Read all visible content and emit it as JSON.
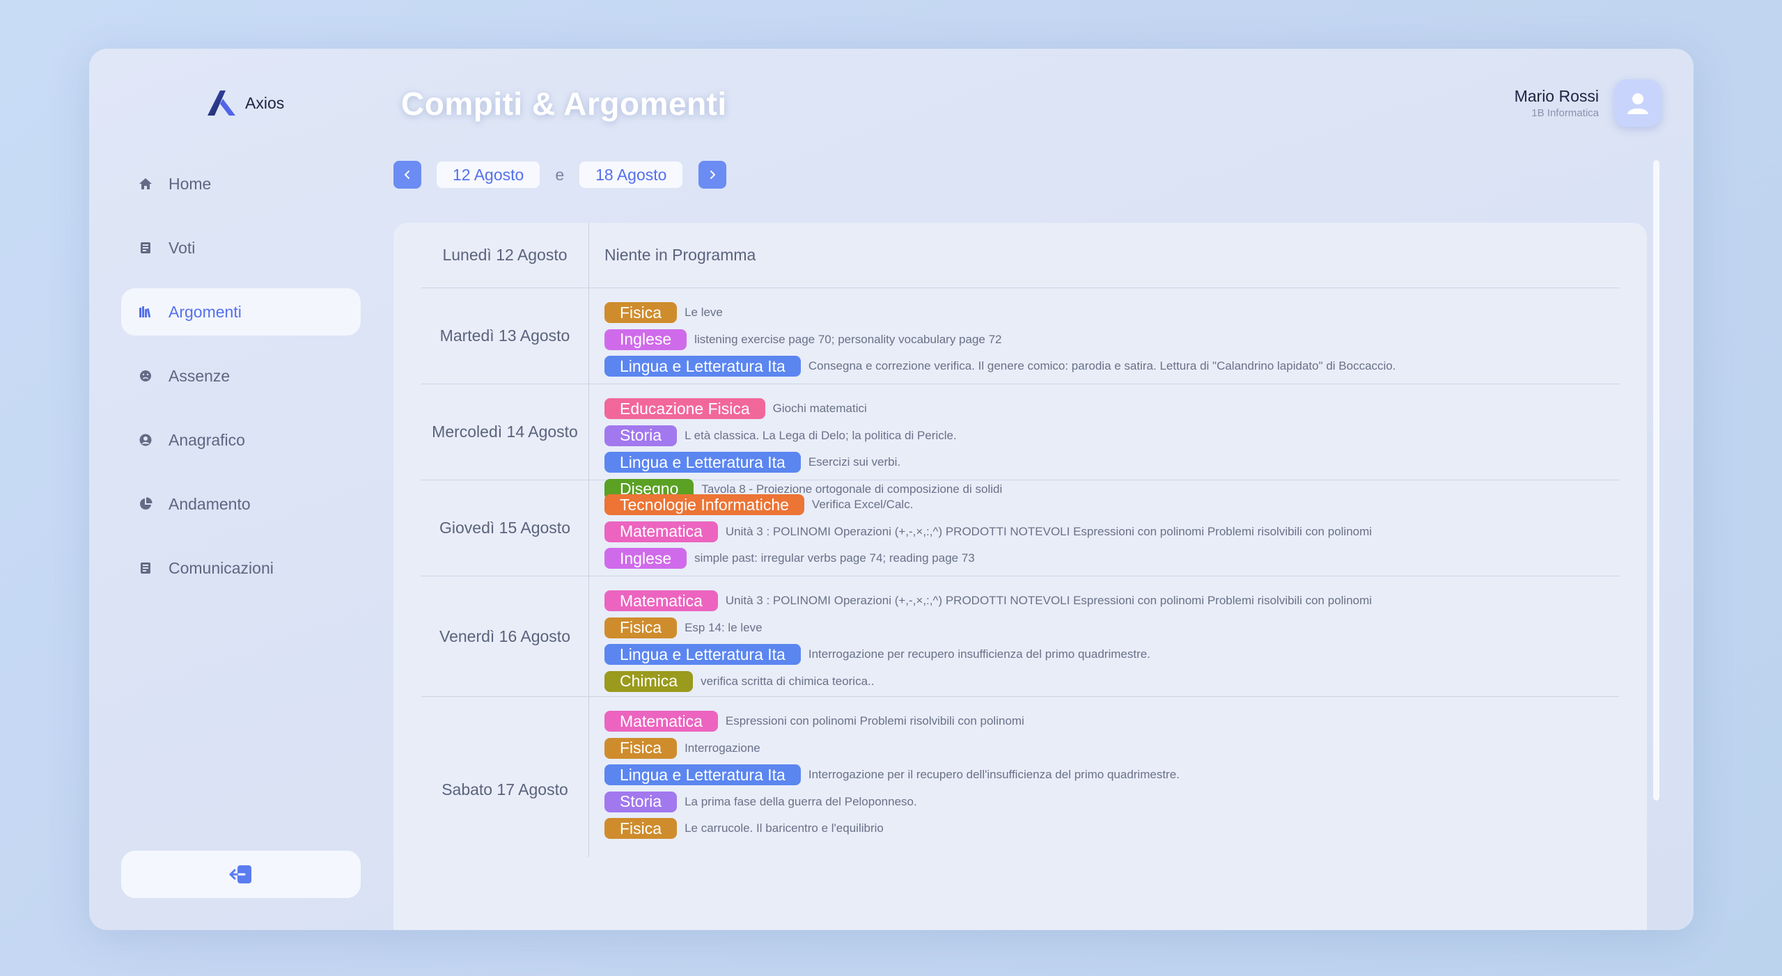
{
  "app": {
    "name": "Axios"
  },
  "page": {
    "title": "Compiti & Argomenti"
  },
  "user": {
    "name": "Mario Rossi",
    "class": "1B Informatica"
  },
  "sidebar": {
    "items": [
      {
        "label": "Home",
        "icon": "home-icon",
        "active": false
      },
      {
        "label": "Voti",
        "icon": "book-icon",
        "active": false
      },
      {
        "label": "Argomenti",
        "icon": "books-icon",
        "active": true
      },
      {
        "label": "Assenze",
        "icon": "face-icon",
        "active": false
      },
      {
        "label": "Anagrafico",
        "icon": "user-circle-icon",
        "active": false
      },
      {
        "label": "Andamento",
        "icon": "pie-chart-icon",
        "active": false
      },
      {
        "label": "Comunicazioni",
        "icon": "document-icon",
        "active": false
      }
    ]
  },
  "range": {
    "from": "12 Agosto",
    "separator": "e",
    "to": "18 Agosto"
  },
  "colors": {
    "accent": "#5570ec",
    "Fisica": "#cf8c2c",
    "Inglese": "#cf6bea",
    "Lingua e Letteratura Ita": "#5b86f0",
    "Educazione Fisica": "#f2679a",
    "Storia": "#a278ee",
    "Disegno": "#5aa124",
    "Tecnologie Informatiche": "#ec7435",
    "Matematica": "#ec64bf",
    "Chimica": "#9a9a1c"
  },
  "days": [
    {
      "label": "Lunedì 12 Agosto",
      "empty": "Niente in Programma",
      "items": []
    },
    {
      "label": "Martedì 13 Agosto",
      "items": [
        {
          "subject": "Fisica",
          "desc": "Le leve"
        },
        {
          "subject": "Inglese",
          "desc": "listening exercise page 70; personality vocabulary page 72"
        },
        {
          "subject": "Lingua e Letteratura Ita",
          "desc": "Consegna e correzione verifica. Il genere comico: parodia e satira. Lettura di \"Calandrino lapidato\" di Boccaccio."
        }
      ]
    },
    {
      "label": "Mercoledì 14 Agosto",
      "items": [
        {
          "subject": "Educazione Fisica",
          "desc": "Giochi matematici"
        },
        {
          "subject": "Storia",
          "desc": "L età classica. La Lega di Delo; la politica di Pericle."
        },
        {
          "subject": "Lingua e Letteratura Ita",
          "desc": "Esercizi sui verbi."
        },
        {
          "subject": "Disegno",
          "desc": "Tavola 8 - Proiezione ortogonale di composizione di solidi"
        }
      ]
    },
    {
      "label": "Giovedì 15 Agosto",
      "items": [
        {
          "subject": "Tecnologie Informatiche",
          "desc": "Verifica Excel/Calc."
        },
        {
          "subject": "Matematica",
          "desc": "Unità 3 : POLINOMI Operazioni (+,-,×,:,^) PRODOTTI NOTEVOLI Espressioni con polinomi Problemi risolvibili con polinomi"
        },
        {
          "subject": "Inglese",
          "desc": "simple past: irregular verbs page 74; reading page 73"
        }
      ]
    },
    {
      "label": "Venerdì 16 Agosto",
      "items": [
        {
          "subject": "Matematica",
          "desc": "Unità 3 : POLINOMI Operazioni (+,-,×,:,^) PRODOTTI NOTEVOLI Espressioni con polinomi Problemi risolvibili con polinomi"
        },
        {
          "subject": "Fisica",
          "desc": "Esp 14: le leve"
        },
        {
          "subject": "Lingua e Letteratura Ita",
          "desc": "Interrogazione per recupero insufficienza del primo quadrimestre."
        },
        {
          "subject": "Chimica",
          "desc": "verifica scritta di chimica teorica.."
        }
      ]
    },
    {
      "label": "Sabato 17 Agosto",
      "items": [
        {
          "subject": "Matematica",
          "desc": "Espressioni con polinomi Problemi risolvibili con polinomi"
        },
        {
          "subject": "Fisica",
          "desc": "Interrogazione"
        },
        {
          "subject": "Lingua e Letteratura Ita",
          "desc": "Interrogazione per il recupero dell'insufficienza del primo quadrimestre."
        },
        {
          "subject": "Storia",
          "desc": "La prima fase della guerra del Peloponneso."
        },
        {
          "subject": "Fisica",
          "desc": "Le carrucole. Il baricentro e l'equilibrio"
        }
      ]
    }
  ]
}
